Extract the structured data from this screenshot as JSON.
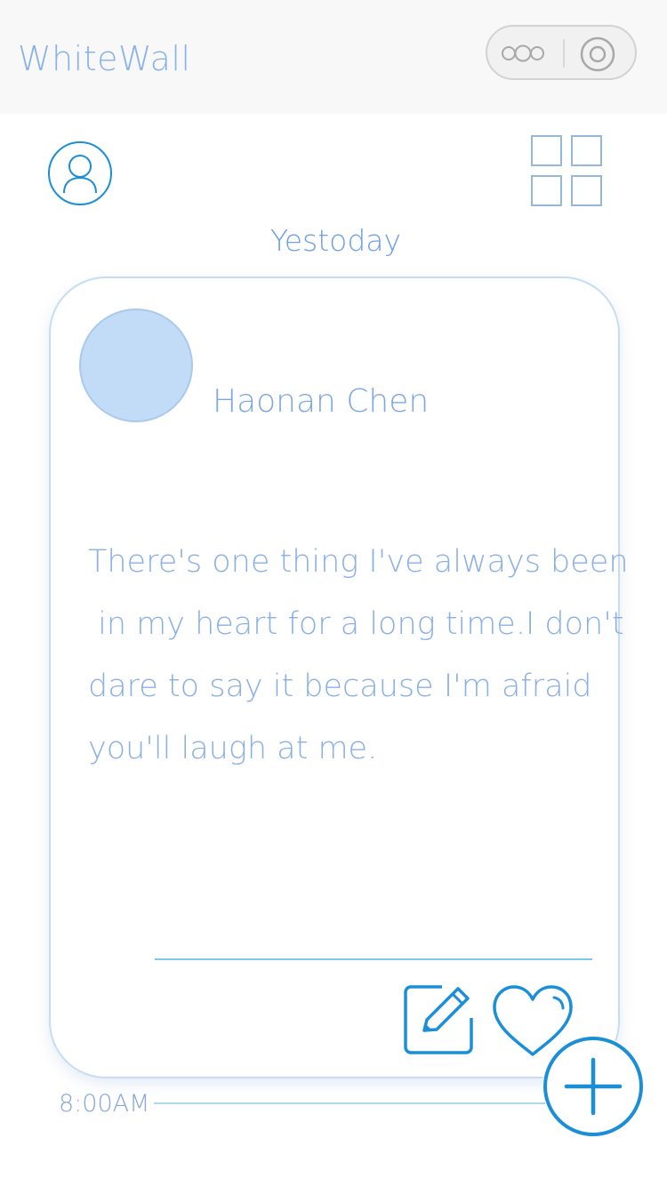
{
  "app": {
    "title": "WhiteWall"
  },
  "capsule": {
    "more_icon": "more-dots-icon",
    "close_icon": "target-close-icon"
  },
  "header": {
    "profile_icon": "user-profile-icon",
    "grid_icon": "grid-view-icon"
  },
  "feed": {
    "day_label": "Yestoday",
    "post": {
      "author": "Haonan Chen",
      "message_lines": [
        "There's one thing I've always been",
        " in my heart for a long time.I don't",
        "dare to say it because I'm afraid",
        "you'll laugh at me."
      ],
      "time": "8:00AM",
      "actions": {
        "edit_icon": "edit-pencil-icon",
        "like_icon": "heart-icon"
      }
    }
  },
  "fab": {
    "icon": "plus-icon"
  },
  "colors": {
    "accent_blue": "#1a8fd8",
    "text_blue": "#8ab0e6",
    "avatar_fill": "#c2dbf7",
    "nav_bg": "#f8f8f8"
  }
}
